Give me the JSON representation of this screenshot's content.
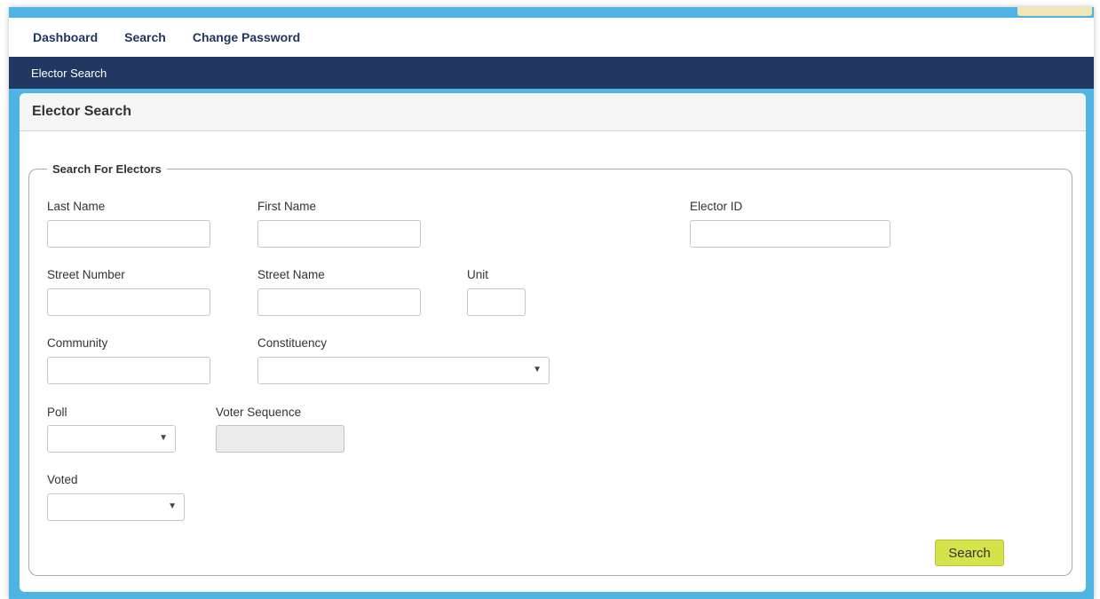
{
  "nav": {
    "items": [
      {
        "label": "Dashboard"
      },
      {
        "label": "Search"
      },
      {
        "label": "Change Password"
      }
    ]
  },
  "breadcrumb": {
    "label": "Elector Search"
  },
  "panel": {
    "title": "Elector Search"
  },
  "form": {
    "legend": "Search For Electors",
    "last_name": {
      "label": "Last Name",
      "value": ""
    },
    "first_name": {
      "label": "First Name",
      "value": ""
    },
    "elector_id": {
      "label": "Elector ID",
      "value": ""
    },
    "street_number": {
      "label": "Street Number",
      "value": ""
    },
    "street_name": {
      "label": "Street Name",
      "value": ""
    },
    "unit": {
      "label": "Unit",
      "value": ""
    },
    "community": {
      "label": "Community",
      "value": ""
    },
    "constituency": {
      "label": "Constituency",
      "value": ""
    },
    "poll": {
      "label": "Poll",
      "value": ""
    },
    "voter_sequence": {
      "label": "Voter Sequence",
      "value": ""
    },
    "voted": {
      "label": "Voted",
      "value": ""
    },
    "search_button": "Search"
  },
  "colors": {
    "frame": "#4fb3e3",
    "breadcrumb_bar": "#223761",
    "search_button": "#d4e34a"
  },
  "icons": {
    "dropdown": "triangle-down"
  }
}
